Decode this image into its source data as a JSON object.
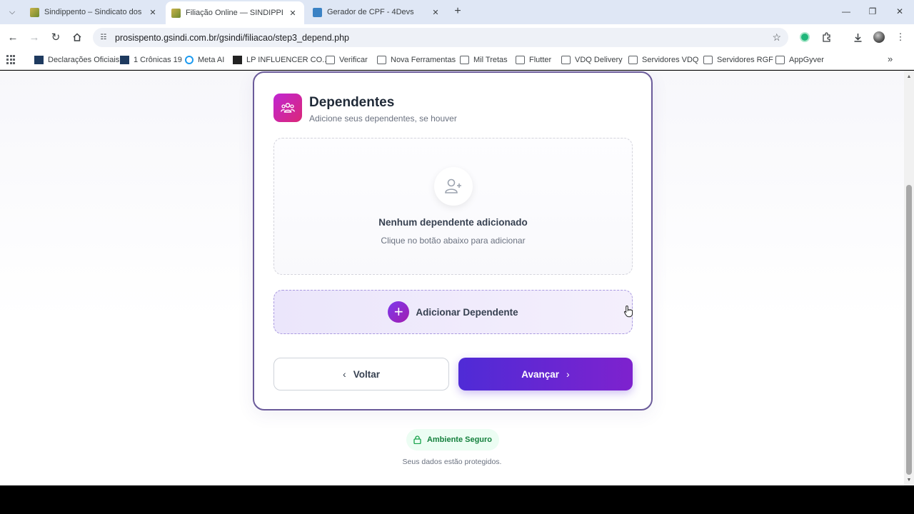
{
  "browser": {
    "tabs": [
      {
        "title": "Sindippento – Sindicato dos Po",
        "active": false
      },
      {
        "title": "Filiação Online — SINDIPPEN-T",
        "active": true
      },
      {
        "title": "Gerador de CPF - 4Devs",
        "active": false
      }
    ],
    "url": "prosispento.gsindi.com.br/gsindi/filiacao/step3_depend.php",
    "bookmarks": [
      "Declarações Oficiais",
      "1 Crônicas 19",
      "Meta AI",
      "LP INFLUENCER CO...",
      "Verificar",
      "Nova Ferramentas",
      "Mil Tretas",
      "Flutter",
      "VDQ Delivery",
      "Servidores VDQ",
      "Servidores RGF",
      "AppGyver"
    ]
  },
  "section": {
    "title": "Dependentes",
    "subtitle": "Adicione seus dependentes, se houver"
  },
  "empty_state": {
    "title": "Nenhum dependente adicionado",
    "subtitle": "Clique no botão abaixo para adicionar"
  },
  "actions": {
    "add_label": "Adicionar Dependente",
    "back_label": "Voltar",
    "next_label": "Avançar"
  },
  "security": {
    "badge": "Ambiente Seguro",
    "note": "Seus dados estão protegidos."
  },
  "colors": {
    "primary": "#5b2cd6",
    "accent_pink": "#c026d3",
    "secure_green": "#15803d"
  }
}
